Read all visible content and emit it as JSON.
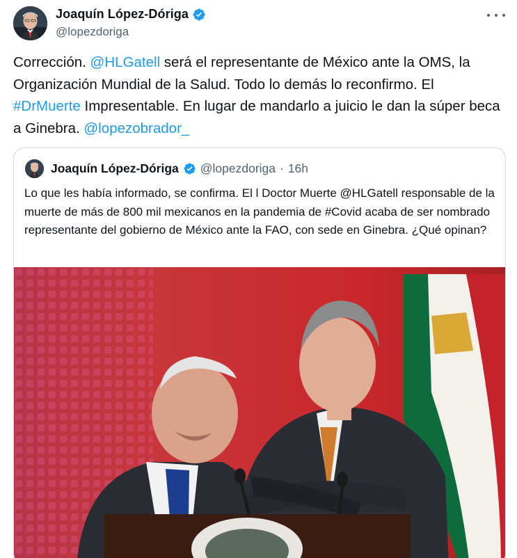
{
  "author": {
    "display_name": "Joaquín López-Dóriga",
    "handle": "@lopezdoriga"
  },
  "tweet": {
    "text_1": "Corrección. ",
    "mention_1": "@HLGatell",
    "text_2": " será el representante de México ante la OMS, la Organización Mundial de la Salud. Todo lo demás lo reconfirmo. El ",
    "hashtag_1": "#DrMuerte",
    "text_3": " Impresentable. En lugar de mandarlo a juicio le dan la súper beca a Ginebra. ",
    "mention_2": "@lopezobrador_"
  },
  "quoted": {
    "display_name": "Joaquín López-Dóriga",
    "handle": "@lopezdoriga",
    "separator": "·",
    "time": "16h",
    "text": "Lo que les había informado, se confirma. El l Doctor Muerte @HLGatell responsable de la muerte de más de 800 mil mexicanos en la pandemia de #Covid acaba de ser nombrado representante del gobierno de México ante la FAO, con sede en Ginebra. ¿Qué opinan?"
  },
  "icons": {
    "verified": "verified-badge-icon",
    "more": "more-options-icon"
  },
  "colors": {
    "link": "#1d9bf0",
    "verified": "#1d9bf0",
    "secondary_text": "#536471",
    "border": "#cfd9de"
  }
}
